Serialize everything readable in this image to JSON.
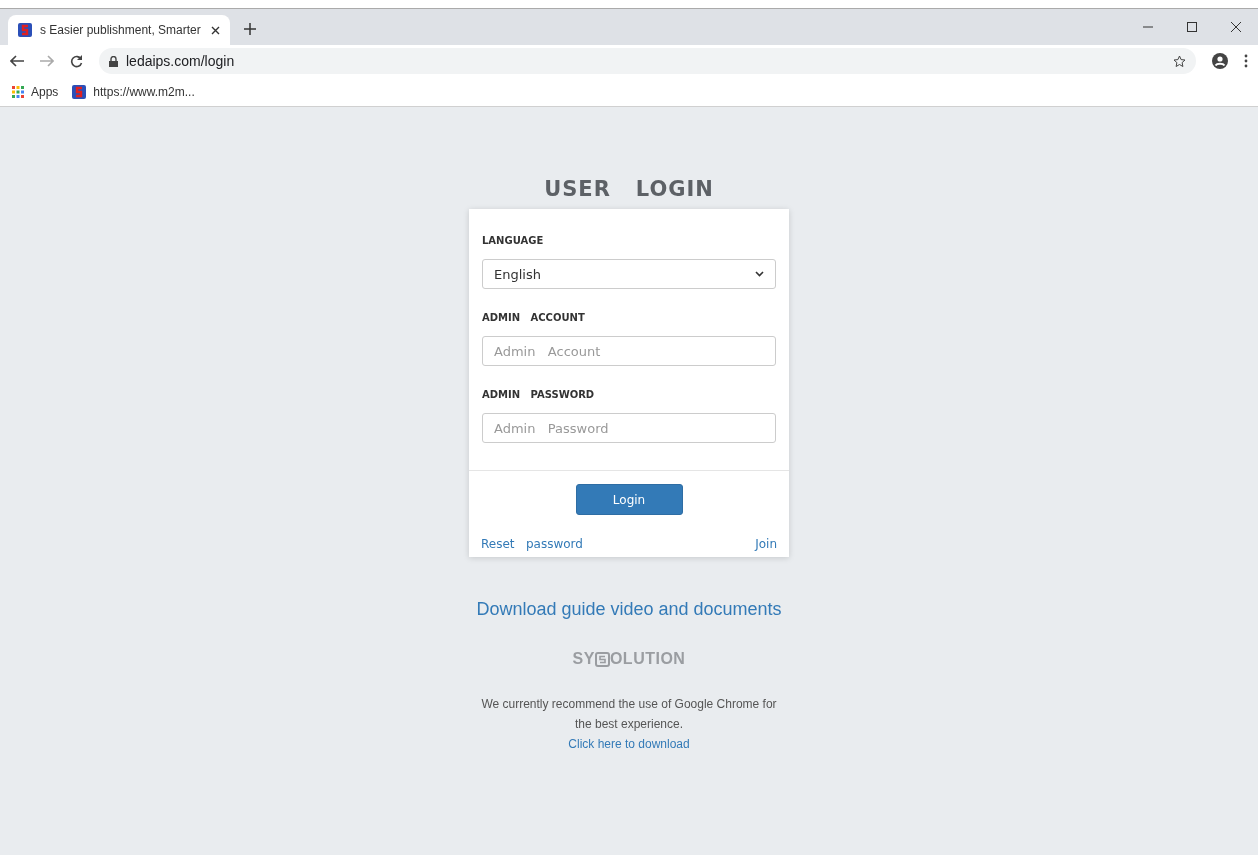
{
  "browser": {
    "tab": {
      "title": "s Easier publishment, Smarter",
      "selected": true
    },
    "url": "ledaips.com/login",
    "bookmarks": [
      {
        "label": "Apps",
        "kind": "apps"
      },
      {
        "label": "https://www.m2m...",
        "kind": "site"
      }
    ]
  },
  "login": {
    "title": "USER   LOGIN",
    "fields": [
      {
        "kind": "select",
        "label": "LANGUAGE",
        "value": "English"
      },
      {
        "kind": "text",
        "label": "ADMIN   ACCOUNT",
        "placeholder": "Admin   Account"
      },
      {
        "kind": "password",
        "label": "ADMIN   PASSWORD",
        "placeholder": "Admin   Password"
      }
    ],
    "button": "Login",
    "reset_link": "Reset   password",
    "join_link": "Join"
  },
  "guide_link": "Download guide video and documents",
  "logo": {
    "prefix": "SY",
    "suffix": "OLUTION"
  },
  "recommendation": "We currently recommend the use of Google Chrome for the best experience.",
  "download_link": "Click here to download"
}
